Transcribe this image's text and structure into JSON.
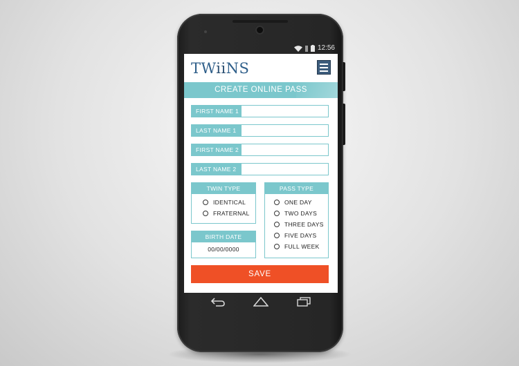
{
  "status_bar": {
    "time": "12:56",
    "wifi_icon": "wifi-icon",
    "battery_icon": "battery-icon"
  },
  "app": {
    "logo_prefix": "TW",
    "logo_ii": "ii",
    "logo_suffix": "NS",
    "menu_icon": "hamburger-menu-icon"
  },
  "form": {
    "title": "CREATE ONLINE PASS",
    "fields": [
      {
        "label": "FIRST NAME 1",
        "value": ""
      },
      {
        "label": "LAST NAME 1",
        "value": ""
      },
      {
        "label": "FIRST NAME 2",
        "value": ""
      },
      {
        "label": "LAST NAME 2",
        "value": ""
      }
    ],
    "twin_type": {
      "heading": "TWIN TYPE",
      "options": [
        "IDENTICAL",
        "FRATERNAL"
      ]
    },
    "pass_type": {
      "heading": "PASS TYPE",
      "options": [
        "ONE DAY",
        "TWO DAYS",
        "THREE DAYS",
        "FIVE DAYS",
        "FULL WEEK"
      ]
    },
    "birth_date": {
      "heading": "BIRTH DATE",
      "value": "00/00/0000"
    },
    "save_label": "SAVE"
  },
  "nav": {
    "back_icon": "back-icon",
    "home_icon": "home-icon",
    "recents_icon": "recents-icon"
  },
  "colors": {
    "accent": "#7bc7cc",
    "save": "#ef5026",
    "logo": "#2f5f8a",
    "menu": "#3c5c7c"
  }
}
